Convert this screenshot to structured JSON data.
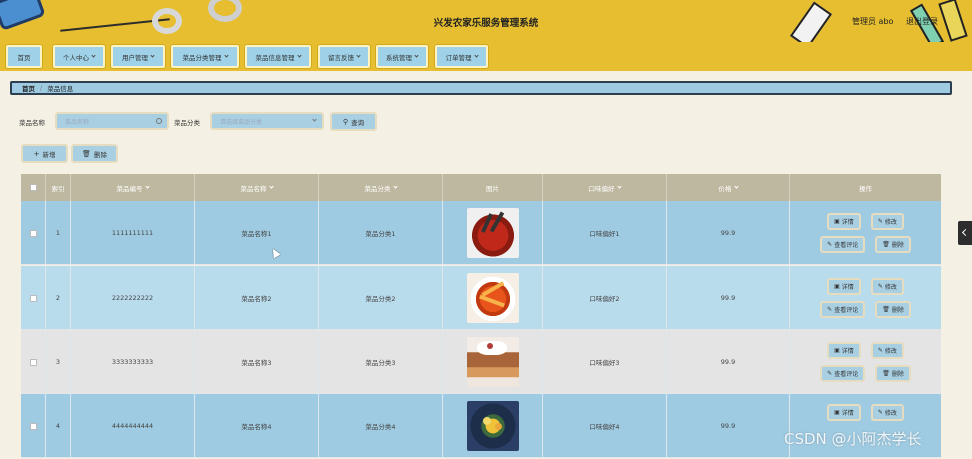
{
  "header": {
    "title": "兴发农家乐服务管理系统",
    "user_label": "管理员 abo",
    "logout_label": "退出登录"
  },
  "nav": {
    "items": [
      {
        "label": "首页",
        "dropdown": false
      },
      {
        "label": "个人中心",
        "dropdown": true
      },
      {
        "label": "用户管理",
        "dropdown": true
      },
      {
        "label": "菜品分类管理",
        "dropdown": true
      },
      {
        "label": "菜品信息管理",
        "dropdown": true
      },
      {
        "label": "留言反馈",
        "dropdown": true
      },
      {
        "label": "系统管理",
        "dropdown": true
      },
      {
        "label": "订单管理",
        "dropdown": true
      }
    ]
  },
  "breadcrumb": {
    "home": "首页",
    "separator": "/",
    "current": "菜品信息"
  },
  "search": {
    "name_label": "菜品名称",
    "name_placeholder": "菜品名称",
    "category_label": "菜品分类",
    "category_placeholder": "请选择菜品分类",
    "query_label": "查询"
  },
  "actions": {
    "add_label": "新增",
    "delete_label": "删除"
  },
  "table": {
    "columns": [
      "",
      "索引",
      "菜品编号",
      "菜品名称",
      "菜品分类",
      "图片",
      "口味偏好",
      "价格",
      "操作"
    ],
    "sortable": [
      false,
      false,
      true,
      true,
      true,
      false,
      true,
      true,
      false
    ],
    "rows": [
      {
        "index": "1",
        "code": "1111111111",
        "name": "菜品名称1",
        "category": "菜品分类1",
        "image": "food-photo-1",
        "taste": "口味偏好1",
        "price": "99.9"
      },
      {
        "index": "2",
        "code": "2222222222",
        "name": "菜品名称2",
        "category": "菜品分类2",
        "image": "food-photo-2",
        "taste": "口味偏好2",
        "price": "99.9"
      },
      {
        "index": "3",
        "code": "3333333333",
        "name": "菜品名称3",
        "category": "菜品分类3",
        "image": "food-photo-3",
        "taste": "口味偏好3",
        "price": "99.9"
      },
      {
        "index": "4",
        "code": "4444444444",
        "name": "菜品名称4",
        "category": "菜品分类4",
        "image": "food-photo-4",
        "taste": "口味偏好4",
        "price": "99.9"
      }
    ],
    "row_actions": {
      "detail": "详情",
      "edit": "修改",
      "comments": "查看评论",
      "delete": "删除"
    }
  },
  "watermark": "CSDN @小阿杰学长",
  "colors": {
    "header_bg": "#e6be2f",
    "nav_button": "#9fd2e8",
    "page_bg": "#f4f1e4",
    "table_header": "#bfb8a0",
    "row_blue": "#9fcbe2",
    "row_light": "#b9dcec",
    "row_gray": "#e4e4e4"
  }
}
